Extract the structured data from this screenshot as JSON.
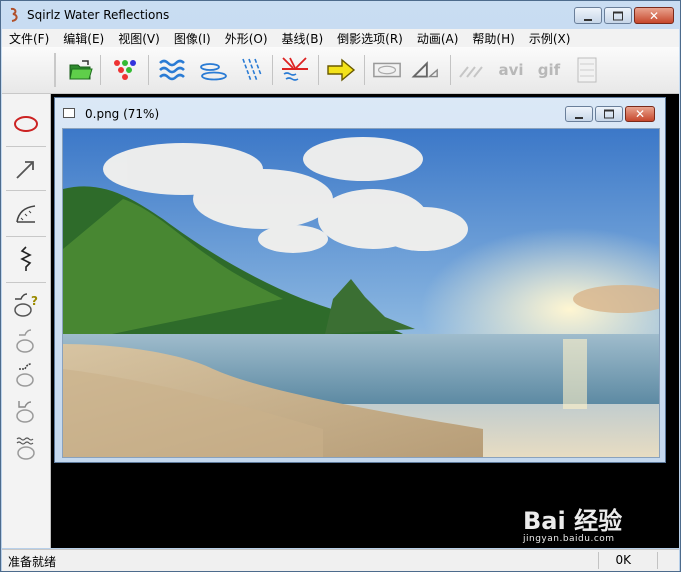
{
  "app": {
    "title": "Sqirlz Water Reflections"
  },
  "menu": [
    "文件(F)",
    "编辑(E)",
    "视图(V)",
    "图像(I)",
    "外形(O)",
    "基线(B)",
    "倒影选项(R)",
    "动画(A)",
    "帮助(H)",
    "示例(X)"
  ],
  "toolbar": {
    "avi_label": "avi",
    "gif_label": "gif"
  },
  "document": {
    "title": "0.png  (71%)"
  },
  "status": {
    "left": "准备就绪",
    "right": "0K"
  },
  "watermark": {
    "brand": "Bai 经验",
    "url": "jingyan.baidu.com"
  },
  "colors": {
    "accent": "#7fb0dc",
    "close": "#c6472c",
    "ellipse": "#cc2222"
  }
}
